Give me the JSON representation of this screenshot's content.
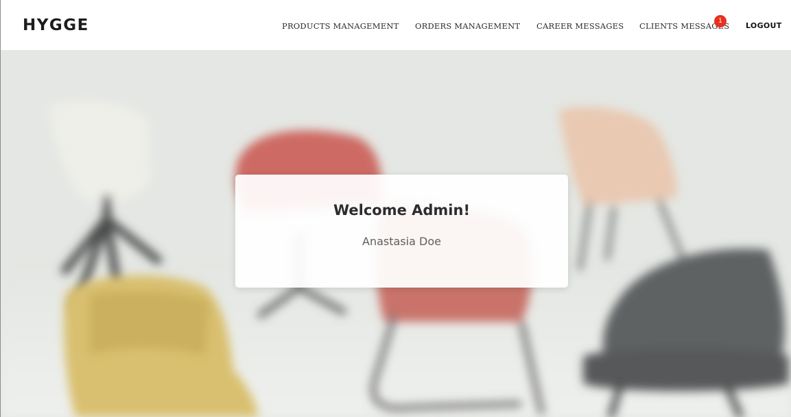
{
  "brand": "HYGGE",
  "nav": {
    "products": "PRODUCTS MANAGEMENT",
    "orders": "ORDERS MANAGEMENT",
    "career": "CAREER MESSAGES",
    "clients": "CLIENTS MESSAGES",
    "clients_badge": "1",
    "logout": "LOGOUT"
  },
  "welcome": {
    "title": "Welcome Admin!",
    "name": "Anastasia Doe"
  },
  "colors": {
    "badge": "#e8301f",
    "text": "#2a2a2a",
    "hero_bg": "#e4e7e3"
  },
  "hero": {
    "image": "blurred-chairs-photo"
  }
}
